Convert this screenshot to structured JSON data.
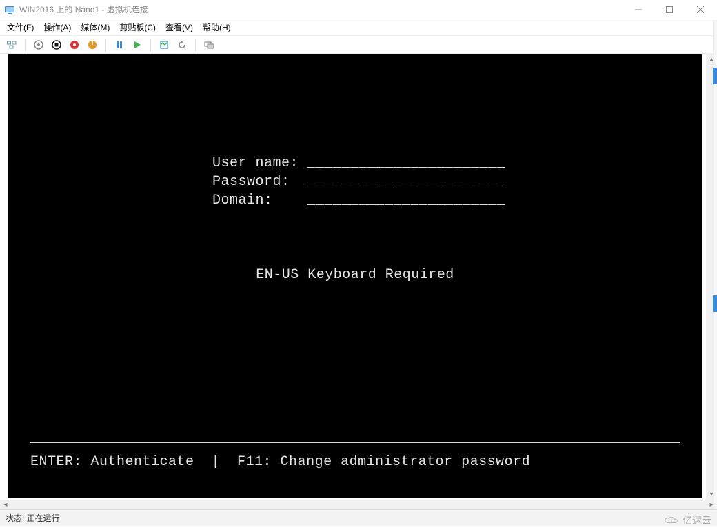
{
  "window": {
    "title": "WIN2016 上的 Nano1 - 虚拟机连接"
  },
  "menu": {
    "file": "文件(F)",
    "action": "操作(A)",
    "media": "媒体(M)",
    "clipboard": "剪贴板(C)",
    "view": "查看(V)",
    "help": "帮助(H)"
  },
  "toolbar_icons": {
    "ctrl_alt_del": "ctrl-alt-del-icon",
    "revert": "revert-icon",
    "stop": "stop-icon",
    "shutdown": "shutdown-icon",
    "save": "save-icon",
    "pause": "pause-icon",
    "start": "start-icon",
    "checkpoint": "checkpoint-icon",
    "undo": "undo-icon",
    "share": "share-icon"
  },
  "console": {
    "username_label": "User name:",
    "password_label": "Password:",
    "domain_label": "Domain:",
    "field_line": "_______________________",
    "kbd_notice": "EN-US Keyboard Required",
    "separator": "_______________________________________________________________________________",
    "help_line": "ENTER: Authenticate  |  F11: Change administrator password"
  },
  "statusbar": {
    "text": "状态: 正在运行"
  },
  "watermark": {
    "text": "亿速云"
  }
}
